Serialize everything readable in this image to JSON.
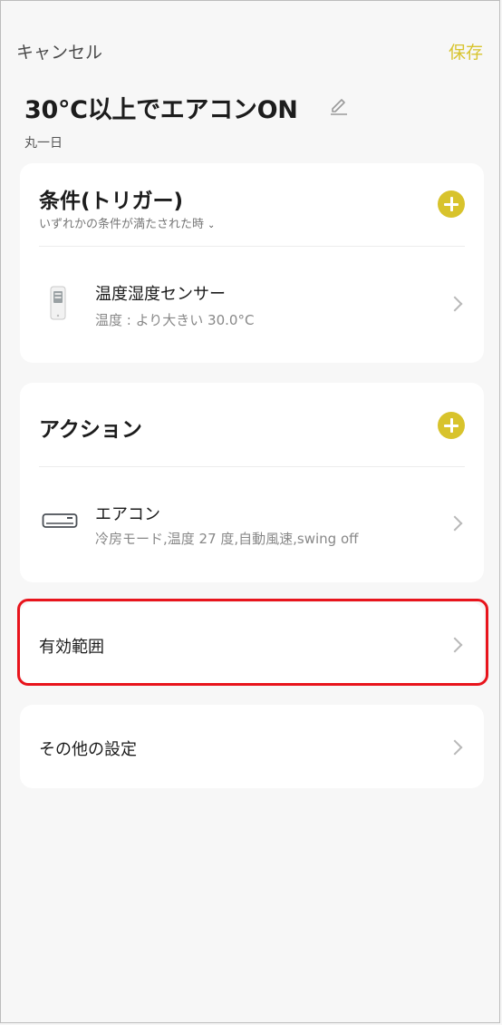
{
  "header": {
    "cancel_label": "キャンセル",
    "save_label": "保存"
  },
  "scene": {
    "title": "30°C以上でエアコンON",
    "schedule": "丸一日"
  },
  "conditions": {
    "title": "条件(トリガー)",
    "match_mode": "いずれかの条件が満たされた時",
    "items": [
      {
        "name": "温度湿度センサー",
        "detail": "温度 : より大きい 30.0°C",
        "icon": "thermo-hygrometer-icon"
      }
    ]
  },
  "actions": {
    "title": "アクション",
    "items": [
      {
        "name": "エアコン",
        "detail": "冷房モード,温度 27 度,自動風速,swing off",
        "icon": "air-conditioner-icon"
      }
    ]
  },
  "effective_range": {
    "label": "有効範囲"
  },
  "other_settings": {
    "label": "その他の設定"
  },
  "colors": {
    "accent": "#d8c32c",
    "highlight": "#e8141c",
    "background": "#f7f7f7"
  }
}
